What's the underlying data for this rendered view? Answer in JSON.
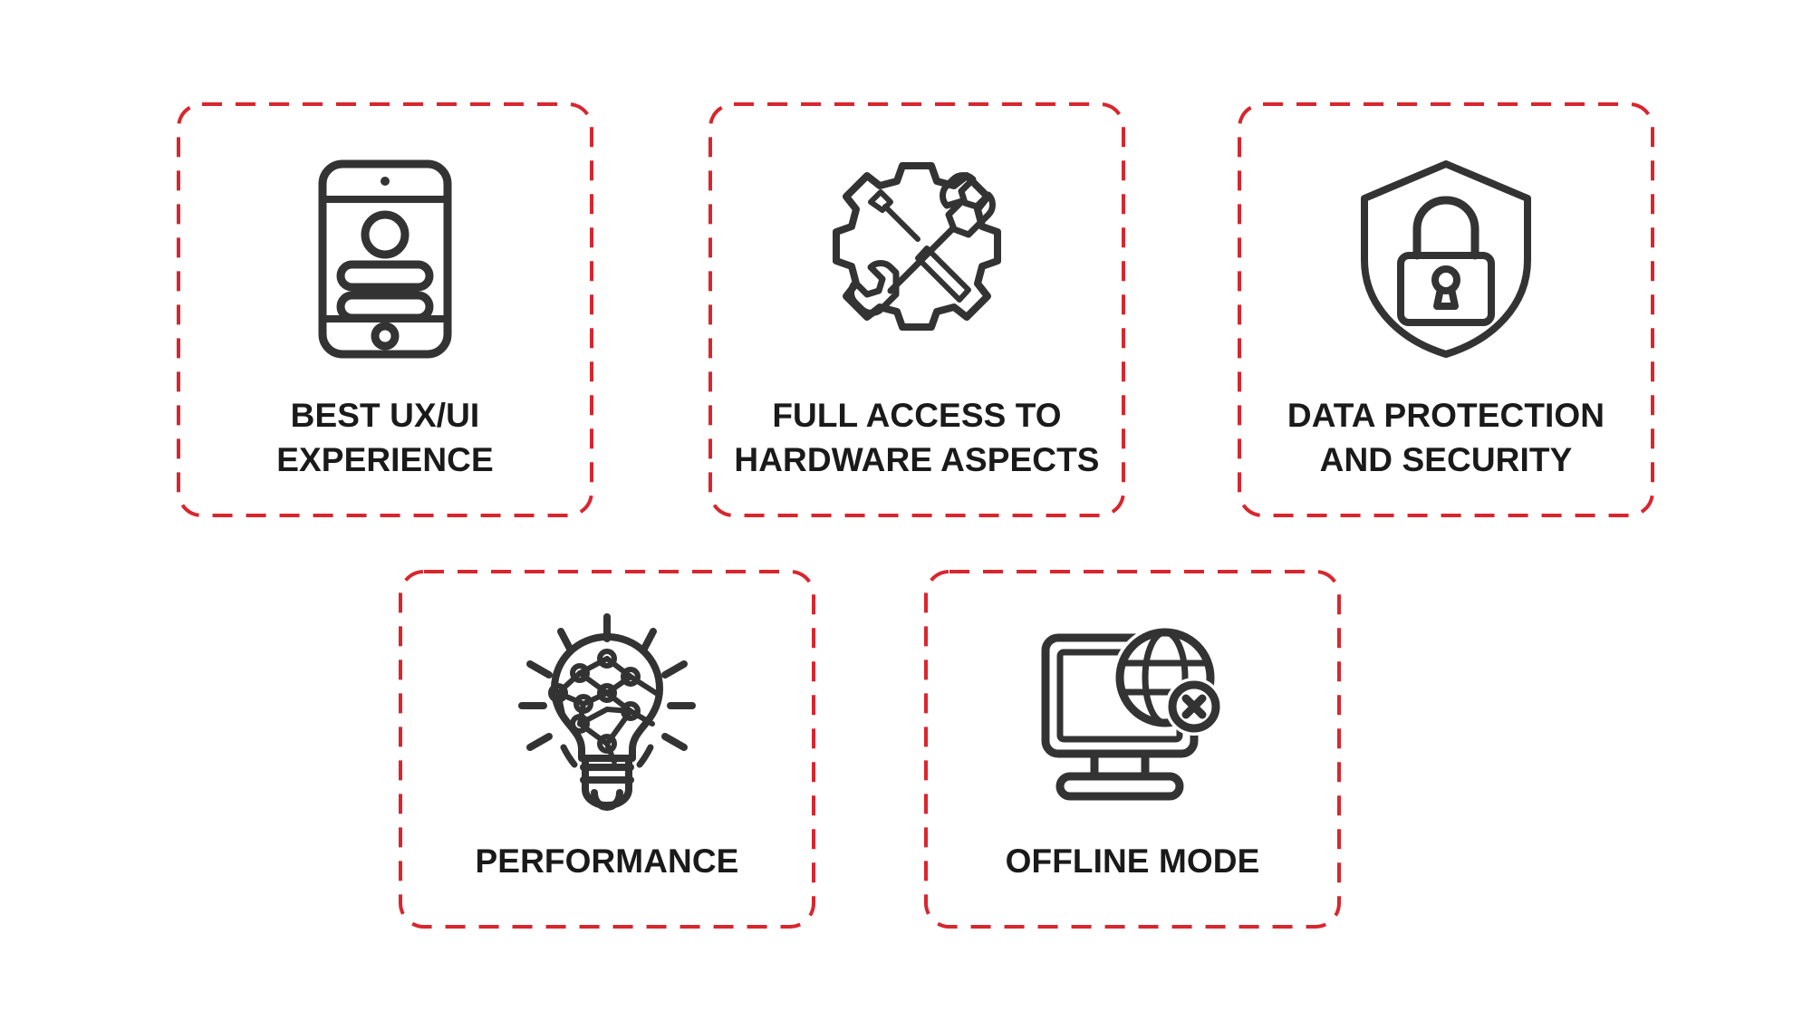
{
  "page": {
    "background_color": "#FFFFFF",
    "accent_border_color": "#D8262E",
    "icon_color": "#333333",
    "text_color": "#1A1A1A"
  },
  "cards": [
    {
      "id": "ux",
      "icon": "smartphone-ui-icon",
      "label": "BEST UX/UI\nEXPERIENCE",
      "line1": "BEST UX/UI",
      "line2": "EXPERIENCE",
      "row": 1
    },
    {
      "id": "hardware",
      "icon": "gear-tools-icon",
      "label": "FULL ACCESS TO\nHARDWARE ASPECTS",
      "line1": "FULL ACCESS TO",
      "line2": "HARDWARE ASPECTS",
      "row": 1
    },
    {
      "id": "security",
      "icon": "shield-lock-icon",
      "label": "DATA PROTECTION\nAND SECURITY",
      "line1": "DATA PROTECTION",
      "line2": "AND SECURITY",
      "row": 1
    },
    {
      "id": "performance",
      "icon": "lightbulb-network-icon",
      "label": "PERFORMANCE",
      "line1": "PERFORMANCE",
      "line2": "",
      "row": 2
    },
    {
      "id": "offline",
      "icon": "monitor-globe-offline-icon",
      "label": "OFFLINE MODE",
      "line1": "OFFLINE MODE",
      "line2": "",
      "row": 2
    }
  ]
}
